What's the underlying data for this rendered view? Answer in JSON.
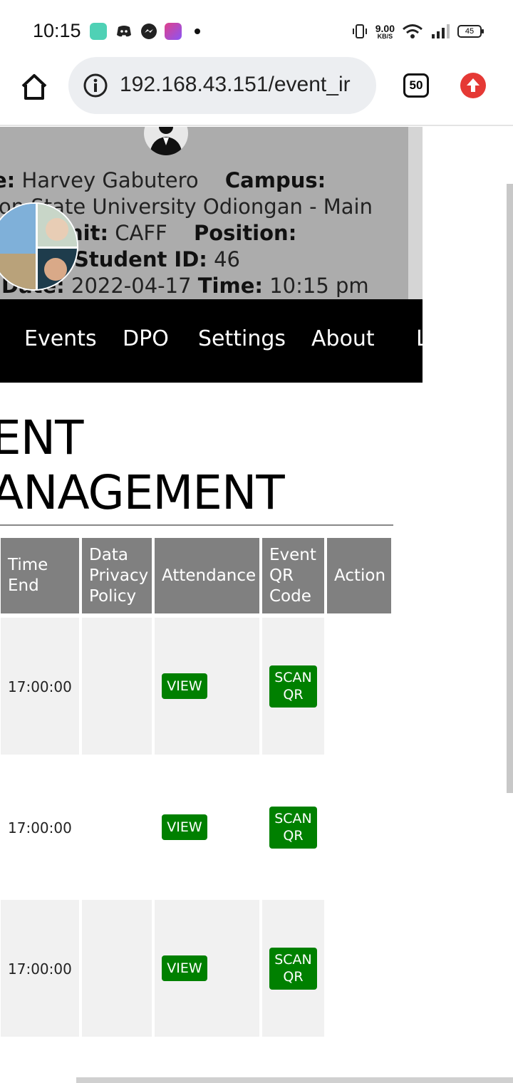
{
  "status_bar": {
    "time": "10:15",
    "net_speed_value": "9.00",
    "net_speed_unit": "KB/S",
    "battery": "45"
  },
  "browser": {
    "url": "192.168.43.151/event_ir",
    "tab_count": "50"
  },
  "profile": {
    "name_label": "e:",
    "name_value": "Harvey  Gabutero",
    "campus_label": "Campus:",
    "campus_value": "lon State University Odiongan - Main",
    "unit_label": "nit:",
    "unit_value": "CAFF",
    "position_label": "Position:",
    "student_id_label": "Student ID:",
    "student_id_value": "46",
    "date_label": "Date:",
    "date_value": "2022-04-17",
    "time_label": "Time:",
    "time_value": "10:15 pm"
  },
  "nav": {
    "items": [
      "Events",
      "DPO",
      "Settings",
      "About",
      "L"
    ]
  },
  "title": {
    "line1": "ENT",
    "line2": "ANAGEMENT"
  },
  "table": {
    "headers": [
      "Time End",
      "Data Privacy Policy",
      "Attendance",
      "Event QR Code",
      "Action"
    ],
    "rows": [
      {
        "time_end": "17:00:00",
        "view_label": "VIEW",
        "scan_label": "SCAN QR"
      },
      {
        "time_end": "17:00:00",
        "view_label": "VIEW",
        "scan_label": "SCAN QR"
      },
      {
        "time_end": "17:00:00",
        "view_label": "VIEW",
        "scan_label": "SCAN QR"
      }
    ]
  },
  "colors": {
    "header_bg": "#acacac",
    "nav_bg": "#000000",
    "table_header_bg": "#808080",
    "button_green": "#008000",
    "row_gray": "#f1f1f1"
  }
}
